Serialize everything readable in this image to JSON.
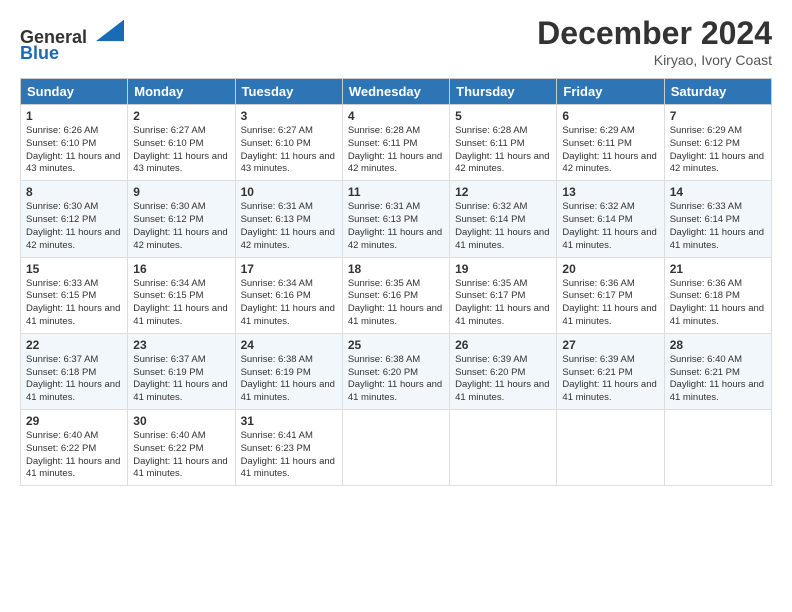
{
  "logo": {
    "line1": "General",
    "line2": "Blue"
  },
  "title": "December 2024",
  "location": "Kiryao, Ivory Coast",
  "days_of_week": [
    "Sunday",
    "Monday",
    "Tuesday",
    "Wednesday",
    "Thursday",
    "Friday",
    "Saturday"
  ],
  "weeks": [
    [
      {
        "day": "1",
        "sunrise": "6:26 AM",
        "sunset": "6:10 PM",
        "daylight": "11 hours and 43 minutes."
      },
      {
        "day": "2",
        "sunrise": "6:27 AM",
        "sunset": "6:10 PM",
        "daylight": "11 hours and 43 minutes."
      },
      {
        "day": "3",
        "sunrise": "6:27 AM",
        "sunset": "6:10 PM",
        "daylight": "11 hours and 43 minutes."
      },
      {
        "day": "4",
        "sunrise": "6:28 AM",
        "sunset": "6:11 PM",
        "daylight": "11 hours and 42 minutes."
      },
      {
        "day": "5",
        "sunrise": "6:28 AM",
        "sunset": "6:11 PM",
        "daylight": "11 hours and 42 minutes."
      },
      {
        "day": "6",
        "sunrise": "6:29 AM",
        "sunset": "6:11 PM",
        "daylight": "11 hours and 42 minutes."
      },
      {
        "day": "7",
        "sunrise": "6:29 AM",
        "sunset": "6:12 PM",
        "daylight": "11 hours and 42 minutes."
      }
    ],
    [
      {
        "day": "8",
        "sunrise": "6:30 AM",
        "sunset": "6:12 PM",
        "daylight": "11 hours and 42 minutes."
      },
      {
        "day": "9",
        "sunrise": "6:30 AM",
        "sunset": "6:12 PM",
        "daylight": "11 hours and 42 minutes."
      },
      {
        "day": "10",
        "sunrise": "6:31 AM",
        "sunset": "6:13 PM",
        "daylight": "11 hours and 42 minutes."
      },
      {
        "day": "11",
        "sunrise": "6:31 AM",
        "sunset": "6:13 PM",
        "daylight": "11 hours and 42 minutes."
      },
      {
        "day": "12",
        "sunrise": "6:32 AM",
        "sunset": "6:14 PM",
        "daylight": "11 hours and 41 minutes."
      },
      {
        "day": "13",
        "sunrise": "6:32 AM",
        "sunset": "6:14 PM",
        "daylight": "11 hours and 41 minutes."
      },
      {
        "day": "14",
        "sunrise": "6:33 AM",
        "sunset": "6:14 PM",
        "daylight": "11 hours and 41 minutes."
      }
    ],
    [
      {
        "day": "15",
        "sunrise": "6:33 AM",
        "sunset": "6:15 PM",
        "daylight": "11 hours and 41 minutes."
      },
      {
        "day": "16",
        "sunrise": "6:34 AM",
        "sunset": "6:15 PM",
        "daylight": "11 hours and 41 minutes."
      },
      {
        "day": "17",
        "sunrise": "6:34 AM",
        "sunset": "6:16 PM",
        "daylight": "11 hours and 41 minutes."
      },
      {
        "day": "18",
        "sunrise": "6:35 AM",
        "sunset": "6:16 PM",
        "daylight": "11 hours and 41 minutes."
      },
      {
        "day": "19",
        "sunrise": "6:35 AM",
        "sunset": "6:17 PM",
        "daylight": "11 hours and 41 minutes."
      },
      {
        "day": "20",
        "sunrise": "6:36 AM",
        "sunset": "6:17 PM",
        "daylight": "11 hours and 41 minutes."
      },
      {
        "day": "21",
        "sunrise": "6:36 AM",
        "sunset": "6:18 PM",
        "daylight": "11 hours and 41 minutes."
      }
    ],
    [
      {
        "day": "22",
        "sunrise": "6:37 AM",
        "sunset": "6:18 PM",
        "daylight": "11 hours and 41 minutes."
      },
      {
        "day": "23",
        "sunrise": "6:37 AM",
        "sunset": "6:19 PM",
        "daylight": "11 hours and 41 minutes."
      },
      {
        "day": "24",
        "sunrise": "6:38 AM",
        "sunset": "6:19 PM",
        "daylight": "11 hours and 41 minutes."
      },
      {
        "day": "25",
        "sunrise": "6:38 AM",
        "sunset": "6:20 PM",
        "daylight": "11 hours and 41 minutes."
      },
      {
        "day": "26",
        "sunrise": "6:39 AM",
        "sunset": "6:20 PM",
        "daylight": "11 hours and 41 minutes."
      },
      {
        "day": "27",
        "sunrise": "6:39 AM",
        "sunset": "6:21 PM",
        "daylight": "11 hours and 41 minutes."
      },
      {
        "day": "28",
        "sunrise": "6:40 AM",
        "sunset": "6:21 PM",
        "daylight": "11 hours and 41 minutes."
      }
    ],
    [
      {
        "day": "29",
        "sunrise": "6:40 AM",
        "sunset": "6:22 PM",
        "daylight": "11 hours and 41 minutes."
      },
      {
        "day": "30",
        "sunrise": "6:40 AM",
        "sunset": "6:22 PM",
        "daylight": "11 hours and 41 minutes."
      },
      {
        "day": "31",
        "sunrise": "6:41 AM",
        "sunset": "6:23 PM",
        "daylight": "11 hours and 41 minutes."
      },
      null,
      null,
      null,
      null
    ]
  ]
}
